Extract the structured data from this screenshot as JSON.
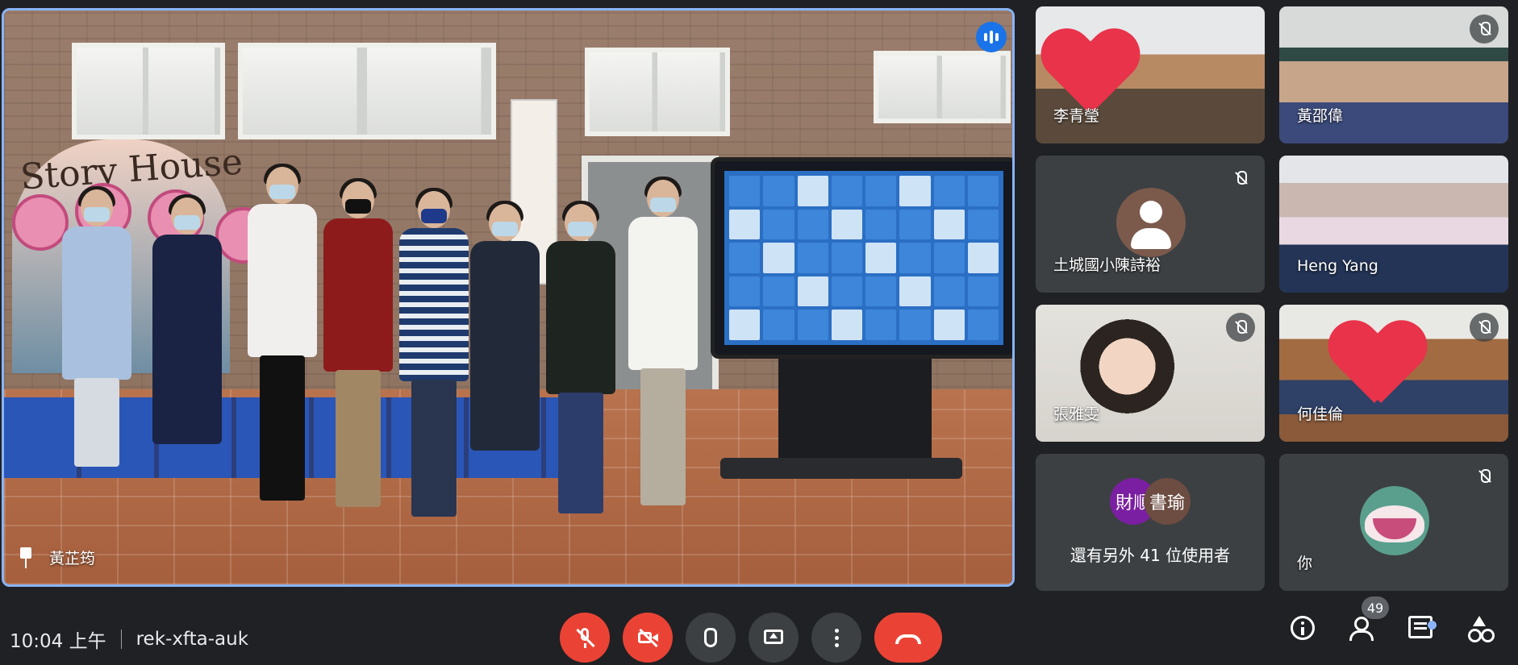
{
  "stage": {
    "participant_name": "黃芷筠",
    "speaking": true,
    "banner_text": "Story House"
  },
  "tiles": [
    {
      "name": "李青瑩",
      "muted": false
    },
    {
      "name": "黃邵偉",
      "muted": true
    },
    {
      "name": "土城國小陳詩裕",
      "muted": true
    },
    {
      "name": "Heng Yang",
      "muted": false
    },
    {
      "name": "張雅雯",
      "muted": true
    },
    {
      "name": "何佳倫",
      "muted": true
    },
    {
      "name": "你",
      "muted": true
    }
  ],
  "others": {
    "avatars": [
      {
        "label": "財順",
        "color": "#7b1fa2"
      },
      {
        "label": "書瑜",
        "color": "#6d4c41"
      }
    ],
    "label": "還有另外 41 位使用者"
  },
  "bottom_bar": {
    "time": "10:04 上午",
    "meeting_code": "rek-xfta-auk",
    "participant_count": "49",
    "controls": [
      "mic-off",
      "camera-off",
      "raise-hand",
      "present",
      "more-options",
      "leave-call"
    ]
  },
  "colors": {
    "background": "#202124",
    "tile_bg": "#3c4043",
    "danger": "#ea4335",
    "accent": "#8ab4f8",
    "speaking": "#1a73e8"
  }
}
